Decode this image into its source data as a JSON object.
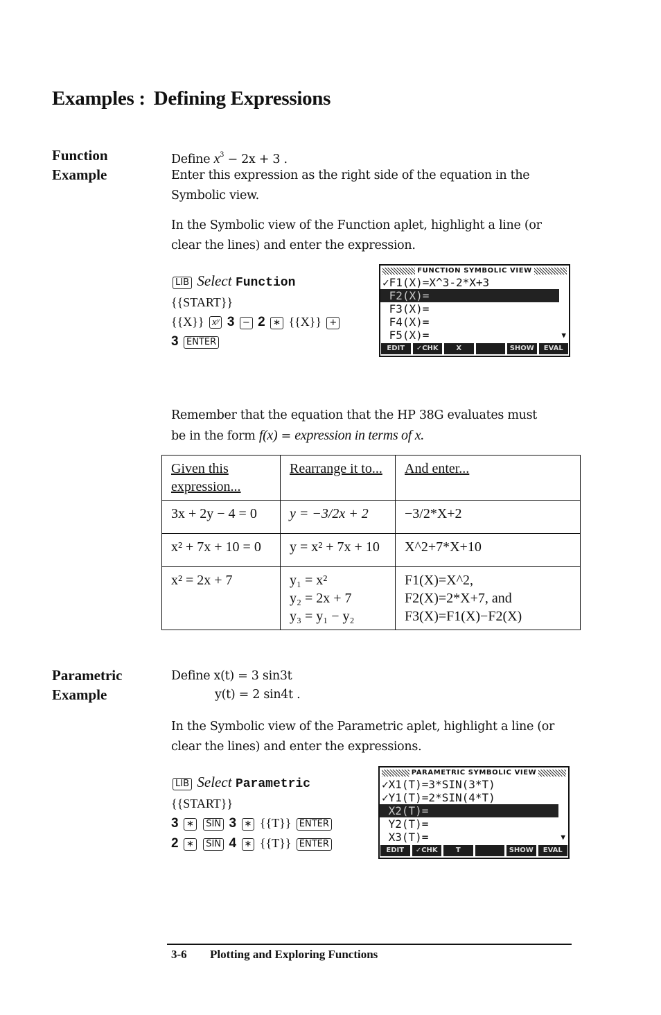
{
  "page": {
    "title_left": "Examples :",
    "title_right": "Defining Expressions"
  },
  "function_example": {
    "side_label_1": "Function",
    "side_label_2": "Example",
    "define_prefix": "Define",
    "define_expr_x": "x",
    "define_expr_exp": "3",
    "define_expr_rest": " − 2x + 3 .",
    "intro": "Enter this expression as the right side of the equation in the Symbolic view.",
    "instructions": "In the Symbolic view of the Function aplet, highlight a line (or clear the lines) and enter the expression.",
    "keystrokes": {
      "lib_key": "LIB",
      "select_word": "Select",
      "select_target": "Function",
      "start": "{{START}}",
      "x_soft": "{{X}}",
      "xy_key": "xʸ",
      "three": "3",
      "minus_key": "−",
      "two": "2",
      "times_key": "∗",
      "x_soft2": "{{X}}",
      "plus_key": "+",
      "three2": "3",
      "enter_key": "ENTER"
    },
    "screen": {
      "title": "FUNCTION SYMBOLIC VIEW",
      "lines": [
        {
          "text": "✓F1(X)=X^3-2*X+3",
          "highlighted": false
        },
        {
          "text": " F2(X)=",
          "highlighted": true
        },
        {
          "text": " F3(X)=",
          "highlighted": false
        },
        {
          "text": " F4(X)=",
          "highlighted": false
        },
        {
          "text": " F5(X)=",
          "highlighted": false
        }
      ],
      "scroll_indicator": "▼",
      "menu": [
        "EDIT",
        "✓CHK",
        "X",
        "",
        "SHOW",
        "EVAL"
      ]
    }
  },
  "remember": {
    "line1": "Remember that the equation that the HP 38G evaluates must",
    "line2_prefix": "be in the form ",
    "line2_fx": "f(x)",
    "line2_eq": " = ",
    "line2_italic": "expression in terms of x."
  },
  "table": {
    "headers": [
      "Given this expression...",
      "Rearrange it to...",
      "And enter..."
    ],
    "rows": [
      {
        "given": "3x + 2y − 4 = 0",
        "rearranged": [
          "y = −3/2x + 2"
        ],
        "enter": [
          "−3/2*X+2"
        ]
      },
      {
        "given": "x² + 7x + 10 = 0",
        "rearranged": [
          "y = x² + 7x + 10"
        ],
        "enter": [
          "X^2+7*X+10"
        ]
      },
      {
        "given": "x² = 2x + 7",
        "rearranged": [
          "y₁ = x²",
          "y₂ = 2x + 7",
          "y₃ = y₁ − y₂"
        ],
        "enter": [
          "F1(X)=X^2,",
          "F2(X)=2*X+7, and",
          "F3(X)=F1(X)−F2(X)"
        ]
      }
    ]
  },
  "parametric_example": {
    "side_label_1": "Parametric",
    "side_label_2": "Example",
    "define_line1": "Define x(t) = 3 sin3t",
    "define_line2": "y(t) = 2 sin4t .",
    "instructions": "In the Symbolic view of the Parametric aplet, highlight a line (or clear the lines) and enter the expressions.",
    "keystrokes": {
      "lib_key": "LIB",
      "select_word": "Select",
      "select_target": "Parametric",
      "start": "{{START}}",
      "row1": [
        "3",
        "∗",
        "SIN",
        "3",
        "∗",
        "{{T}}",
        "ENTER"
      ],
      "row2": [
        "2",
        "∗",
        "SIN",
        "4",
        "∗",
        "{{T}}",
        "ENTER"
      ]
    },
    "screen": {
      "title": "PARAMETRIC SYMBOLIC VIEW",
      "lines": [
        {
          "text": "✓X1(T)=3*SIN(3*T)",
          "highlighted": false
        },
        {
          "text": "✓Y1(T)=2*SIN(4*T)",
          "highlighted": false
        },
        {
          "text": " X2(T)=",
          "highlighted": true
        },
        {
          "text": " Y2(T)=",
          "highlighted": false
        },
        {
          "text": " X3(T)=",
          "highlighted": false
        }
      ],
      "scroll_indicator": "▼",
      "menu": [
        "EDIT",
        "✓CHK",
        "T",
        "",
        "SHOW",
        "EVAL"
      ]
    }
  },
  "footer": {
    "page_number": "3-6",
    "chapter": "Plotting and Exploring Functions"
  }
}
